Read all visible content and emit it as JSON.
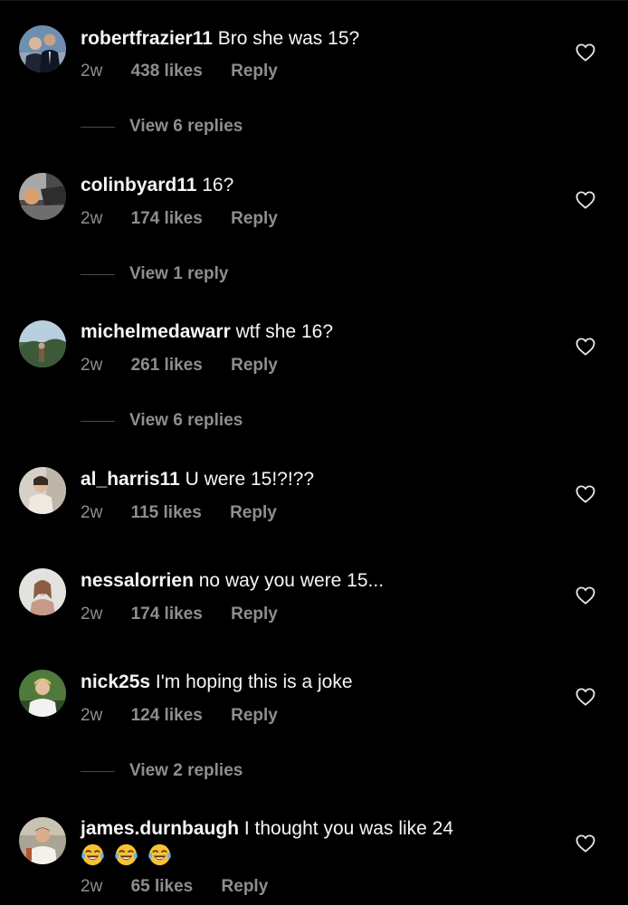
{
  "comments": [
    {
      "username": "robertfrazier11",
      "text": "Bro she was 15?",
      "time": "2w",
      "likes": "438 likes",
      "reply": "Reply",
      "view_replies": "View 6 replies",
      "avatar": "avatar-two-men-suits"
    },
    {
      "username": "colinbyard11",
      "text": "16?",
      "time": "2w",
      "likes": "174 likes",
      "reply": "Reply",
      "view_replies": "View 1 reply",
      "avatar": "avatar-dark-outdoor"
    },
    {
      "username": "michelmedawarr",
      "text": "wtf she 16?",
      "time": "2w",
      "likes": "261 likes",
      "reply": "Reply",
      "view_replies": "View 6 replies",
      "avatar": "avatar-landscape"
    },
    {
      "username": "al_harris11",
      "text": "U were 15!?!??",
      "time": "2w",
      "likes": "115 likes",
      "reply": "Reply",
      "avatar": "avatar-person-light"
    },
    {
      "username": "nessalorrien",
      "text": "no way you were 15...",
      "time": "2w",
      "likes": "174 likes",
      "reply": "Reply",
      "avatar": "avatar-person-pale"
    },
    {
      "username": "nick25s",
      "text": "I'm hoping this is a joke",
      "time": "2w",
      "likes": "124 likes",
      "reply": "Reply",
      "view_replies": "View 2 replies",
      "avatar": "avatar-blond-person"
    },
    {
      "username": "james.durnbaugh",
      "text": "I thought you was like 24",
      "emojis": [
        "😂",
        "😂",
        "😂"
      ],
      "time": "2w",
      "likes": "65 likes",
      "reply": "Reply",
      "avatar": "avatar-person-white-shirt"
    }
  ],
  "icons": {
    "like": "heart-outline-icon",
    "emoji": "tears-of-joy-emoji"
  },
  "colors": {
    "background": "#000000",
    "primary_text": "#f5f5f5",
    "secondary_text": "#8e8e8e",
    "divider": "#4a4a4a"
  }
}
